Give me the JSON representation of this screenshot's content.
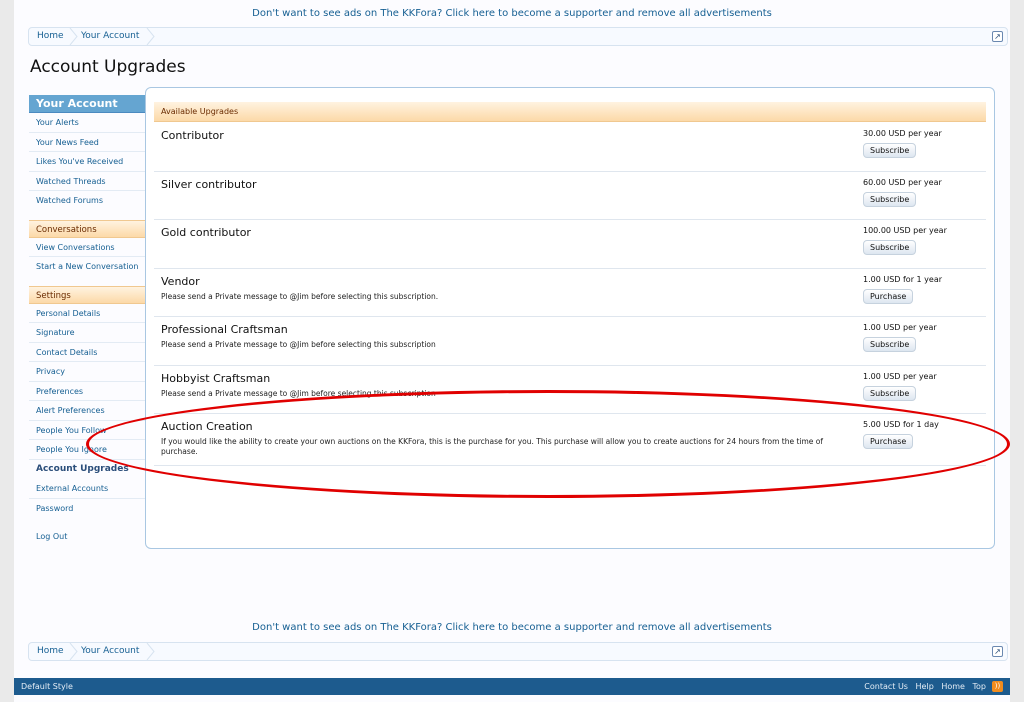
{
  "ad_text": "Don't want to see ads on The KKFora? Click here to become a supporter and remove all advertisements",
  "breadcrumb": {
    "home": "Home",
    "current": "Your Account",
    "jump_icon": "jump-to-arrow-icon"
  },
  "page_title": "Account Upgrades",
  "sidebar": {
    "header": "Your Account",
    "group1": [
      "Your Alerts",
      "Your News Feed",
      "Likes You've Received",
      "Watched Threads",
      "Watched Forums"
    ],
    "conversations_label": "Conversations",
    "group2": [
      "View Conversations",
      "Start a New Conversation"
    ],
    "settings_label": "Settings",
    "group3": [
      "Personal Details",
      "Signature",
      "Contact Details",
      "Privacy",
      "Preferences",
      "Alert Preferences",
      "People You Follow",
      "People You Ignore"
    ],
    "active": "Account Upgrades",
    "group4": [
      "External Accounts",
      "Password"
    ],
    "logout": "Log Out"
  },
  "upgrades": {
    "header": "Available Upgrades",
    "items": [
      {
        "title": "Contributor",
        "desc": "",
        "cost": "30.00 USD per year",
        "button": "Subscribe"
      },
      {
        "title": "Silver contributor",
        "desc": "",
        "cost": "60.00 USD per year",
        "button": "Subscribe"
      },
      {
        "title": "Gold contributor",
        "desc": "",
        "cost": "100.00 USD per year",
        "button": "Subscribe"
      },
      {
        "title": "Vendor",
        "desc": "Please send a Private message to @Jim before selecting this subscription.",
        "cost": "1.00 USD for 1 year",
        "button": "Purchase"
      },
      {
        "title": "Professional Craftsman",
        "desc": "Please send a Private message to @Jim before selecting this subscription",
        "cost": "1.00 USD per year",
        "button": "Subscribe"
      },
      {
        "title": "Hobbyist Craftsman",
        "desc": "Please send a Private message to @Jim before selecting this subscription",
        "cost": "1.00 USD per year",
        "button": "Subscribe"
      },
      {
        "title": "Auction Creation",
        "desc": "If you would like the ability to create your own auctions on the KKFora, this is the purchase for you. This purchase will allow you to create auctions for 24 hours from the time of purchase.",
        "cost": "5.00 USD for 1 day",
        "button": "Purchase"
      }
    ]
  },
  "footer": {
    "style": "Default Style",
    "links": [
      "Contact Us",
      "Help",
      "Home",
      "Top"
    ],
    "rss_icon": "rss-icon"
  },
  "colors": {
    "accent": "#176093",
    "annotation": "#e00000",
    "footer_bg": "#1d5b8e"
  }
}
